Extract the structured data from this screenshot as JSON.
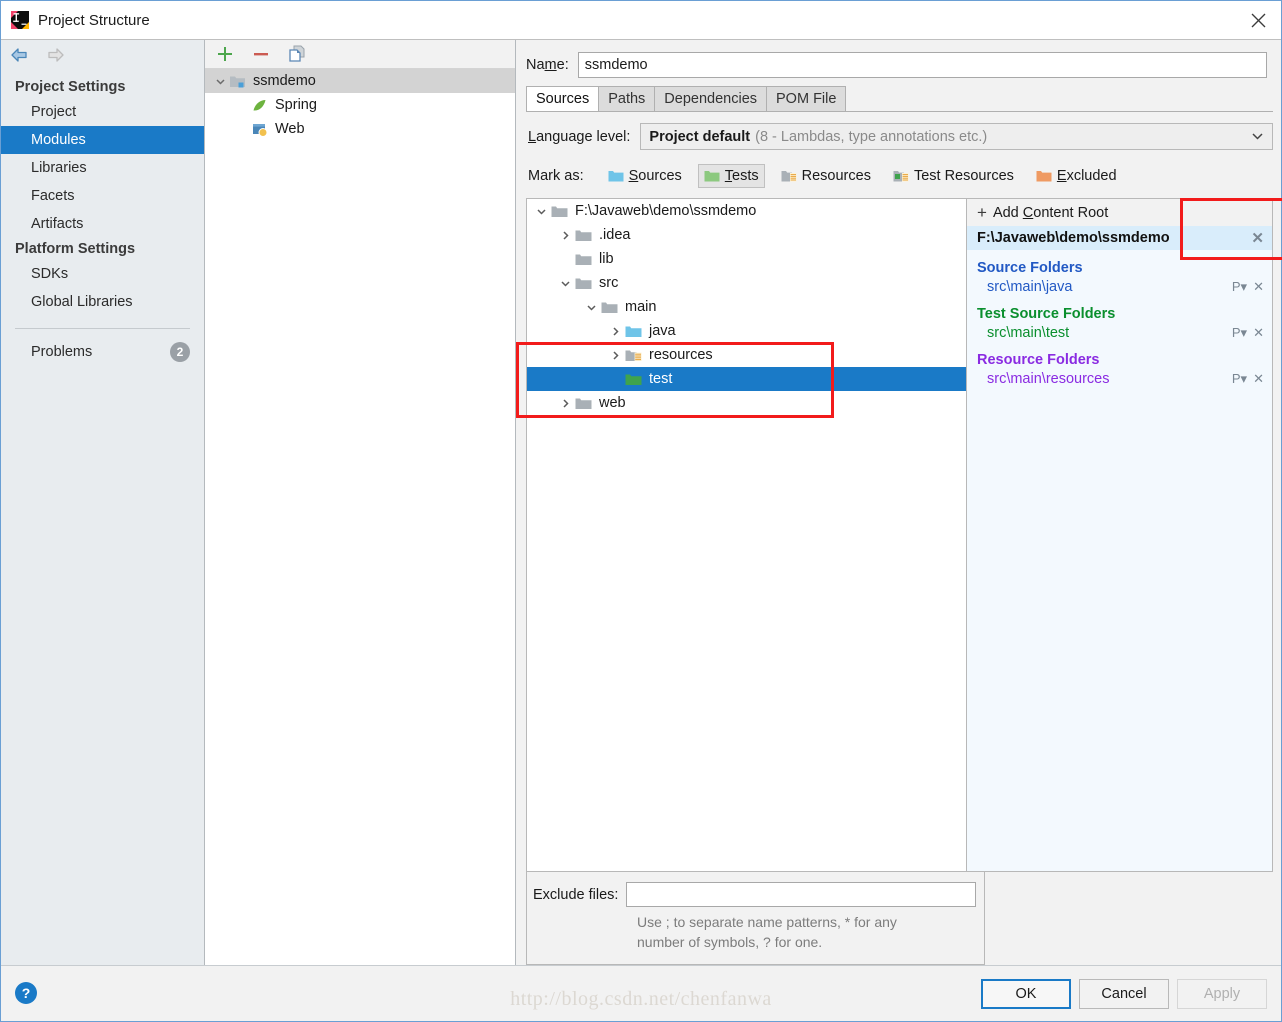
{
  "window": {
    "title": "Project Structure",
    "logo_icon": "intellij-idea-logo",
    "close_icon": "close-icon"
  },
  "nav": {
    "back_icon": "arrow-left-icon",
    "forward_icon": "arrow-right-icon"
  },
  "sidebar": {
    "groups": [
      {
        "label": "Project Settings",
        "items": [
          {
            "label": "Project",
            "selected": false
          },
          {
            "label": "Modules",
            "selected": true
          },
          {
            "label": "Libraries",
            "selected": false
          },
          {
            "label": "Facets",
            "selected": false
          },
          {
            "label": "Artifacts",
            "selected": false
          }
        ]
      },
      {
        "label": "Platform Settings",
        "items": [
          {
            "label": "SDKs",
            "selected": false
          },
          {
            "label": "Global Libraries",
            "selected": false
          }
        ]
      }
    ],
    "problems": {
      "label": "Problems",
      "count": "2"
    }
  },
  "help": {
    "icon": "help-question-icon",
    "label": "?"
  },
  "module_panel": {
    "toolbar": {
      "add_icon": "plus-icon",
      "remove_icon": "minus-icon",
      "copy_icon": "copy-icon"
    },
    "tree": [
      {
        "label": "ssmdemo",
        "icon": "module-folder-icon",
        "chevron": "chevron-down",
        "indent": 0,
        "selected": true
      },
      {
        "label": "Spring",
        "icon": "spring-leaf-icon",
        "chevron": "",
        "indent": 1,
        "selected": false
      },
      {
        "label": "Web",
        "icon": "web-facet-icon",
        "chevron": "",
        "indent": 1,
        "selected": false
      }
    ]
  },
  "detail": {
    "name_label": "Name:",
    "name_value": "ssmdemo",
    "tabs": [
      {
        "label": "Sources",
        "active": true
      },
      {
        "label": "Paths",
        "active": false
      },
      {
        "label": "Dependencies",
        "active": false
      },
      {
        "label": "POM File",
        "active": false
      }
    ],
    "language_level": {
      "label": "Language level:",
      "value_strong": "Project default",
      "value_dim": "(8 - Lambdas, type annotations etc.)",
      "caret_icon": "chevron-down-icon"
    },
    "mark_as": {
      "label": "Mark as:",
      "options": [
        {
          "label": "Sources",
          "underline": "S",
          "icon": "folder-sources-icon",
          "color": "#6fc4e8",
          "hovered": false
        },
        {
          "label": "Tests",
          "underline": "T",
          "icon": "folder-tests-icon",
          "color": "#8cc97f",
          "hovered": true
        },
        {
          "label": "Resources",
          "underline": "",
          "icon": "folder-resources-icon",
          "color": "#a9b0b6",
          "hovered": false
        },
        {
          "label": "Test Resources",
          "underline": "",
          "icon": "folder-test-resources-icon",
          "color": "#a9b0b6",
          "hovered": false
        },
        {
          "label": "Excluded",
          "underline": "E",
          "icon": "folder-excluded-icon",
          "color": "#ef9a62",
          "hovered": false
        }
      ]
    },
    "source_tree": [
      {
        "label": "F:\\Javaweb\\demo\\ssmdemo",
        "indent": 0,
        "chevron": "chevron-down",
        "icon": "folder-icon",
        "color": "#a9b0b6",
        "selected": false
      },
      {
        "label": ".idea",
        "indent": 1,
        "chevron": "chevron-right",
        "icon": "folder-icon",
        "color": "#a9b0b6",
        "selected": false
      },
      {
        "label": "lib",
        "indent": 1,
        "chevron": "",
        "icon": "folder-icon",
        "color": "#a9b0b6",
        "selected": false
      },
      {
        "label": "src",
        "indent": 1,
        "chevron": "chevron-down",
        "icon": "folder-icon",
        "color": "#a9b0b6",
        "selected": false
      },
      {
        "label": "main",
        "indent": 2,
        "chevron": "chevron-down",
        "icon": "folder-icon",
        "color": "#a9b0b6",
        "selected": false
      },
      {
        "label": "java",
        "indent": 3,
        "chevron": "chevron-right",
        "icon": "folder-sources-icon",
        "color": "#6fc4e8",
        "selected": false
      },
      {
        "label": "resources",
        "indent": 3,
        "chevron": "chevron-right",
        "icon": "folder-resources-icon",
        "color": "#a9b0b6",
        "selected": false
      },
      {
        "label": "test",
        "indent": 3,
        "chevron": "",
        "icon": "folder-tests-icon",
        "color": "#3fa34d",
        "selected": true
      },
      {
        "label": "web",
        "indent": 1,
        "chevron": "chevron-right",
        "icon": "folder-icon",
        "color": "#a9b0b6",
        "selected": false
      }
    ],
    "content_roots": {
      "add_label": "Add Content Root",
      "add_icon": "plus-icon",
      "root_path": "F:\\Javaweb\\demo\\ssmdemo",
      "root_close_icon": "close-icon",
      "groups": [
        {
          "title": "Source Folders",
          "color": "#2259c4",
          "folders": [
            {
              "path": "src\\main\\java",
              "props_icon": "properties-icon",
              "remove_icon": "close-icon"
            }
          ]
        },
        {
          "title": "Test Source Folders",
          "color": "#0a8f2e",
          "folders": [
            {
              "path": "src\\main\\test",
              "props_icon": "properties-icon",
              "remove_icon": "close-icon"
            }
          ]
        },
        {
          "title": "Resource Folders",
          "color": "#8a2be2",
          "folders": [
            {
              "path": "src\\main\\resources",
              "props_icon": "properties-icon",
              "remove_icon": "close-icon"
            }
          ]
        }
      ]
    },
    "exclude": {
      "label": "Exclude files:",
      "value": "",
      "hint": "Use ; to separate name patterns, * for any number of symbols, ? for one."
    }
  },
  "footer": {
    "buttons": [
      {
        "label": "OK",
        "default": true,
        "disabled": false
      },
      {
        "label": "Cancel",
        "default": false,
        "disabled": false
      },
      {
        "label": "Apply",
        "default": false,
        "disabled": true
      }
    ],
    "watermark": "http://blog.csdn.net/chenfanwa"
  },
  "annotations": {
    "box_tests": "red-highlight-box",
    "box_tree": "red-highlight-box"
  }
}
